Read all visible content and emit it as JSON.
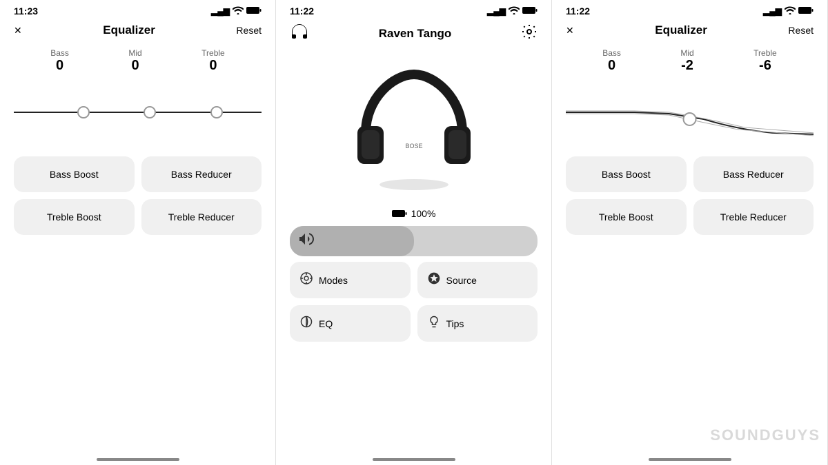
{
  "colors": {
    "background": "#ffffff",
    "panel_bg": "#ffffff",
    "preset_btn_bg": "#f0f0f0",
    "menu_btn_bg": "#f0f0f0",
    "track": "#222222",
    "accent": "#000000"
  },
  "left_panel": {
    "status": {
      "time": "11:23",
      "time_icon": "▶",
      "signal": "▂▄▆",
      "wifi": "WiFi",
      "battery": "🔋"
    },
    "header": {
      "close_label": "✕",
      "title": "Equalizer",
      "reset_label": "Reset"
    },
    "eq": {
      "bass_label": "Bass",
      "bass_value": "0",
      "mid_label": "Mid",
      "mid_value": "0",
      "treble_label": "Treble",
      "treble_value": "0"
    },
    "presets": [
      {
        "id": "bass-boost",
        "label": "Bass Boost"
      },
      {
        "id": "bass-reducer",
        "label": "Bass Reducer"
      },
      {
        "id": "treble-boost",
        "label": "Treble Boost"
      },
      {
        "id": "treble-reducer",
        "label": "Treble Reducer"
      }
    ]
  },
  "center_panel": {
    "status": {
      "time": "11:22",
      "time_icon": "▶"
    },
    "header": {
      "headphone_icon": "🎧",
      "title": "Raven Tango",
      "settings_icon": "⚙"
    },
    "battery": {
      "icon": "🔋",
      "percent": "100%"
    },
    "volume": {
      "icon": "🔊"
    },
    "menu": [
      {
        "id": "modes",
        "icon": "◎",
        "label": "Modes"
      },
      {
        "id": "source",
        "icon": "𝛃",
        "label": "Source"
      },
      {
        "id": "eq",
        "icon": "◑",
        "label": "EQ"
      },
      {
        "id": "tips",
        "icon": "💡",
        "label": "Tips"
      }
    ]
  },
  "right_panel": {
    "status": {
      "time": "11:22",
      "time_icon": "▶",
      "signal": "▂▄▆",
      "wifi": "WiFi",
      "battery": "🔋"
    },
    "header": {
      "close_label": "✕",
      "title": "Equalizer",
      "reset_label": "Reset"
    },
    "eq": {
      "bass_label": "Bass",
      "bass_value": "0",
      "mid_label": "Mid",
      "mid_value": "-2",
      "treble_label": "Treble",
      "treble_value": "-6"
    },
    "presets": [
      {
        "id": "bass-boost",
        "label": "Bass Boost"
      },
      {
        "id": "bass-reducer",
        "label": "Bass Reducer"
      },
      {
        "id": "treble-boost",
        "label": "Treble Boost"
      },
      {
        "id": "treble-reducer",
        "label": "Treble Reducer"
      }
    ]
  },
  "watermark": "SOUNDGUYS"
}
